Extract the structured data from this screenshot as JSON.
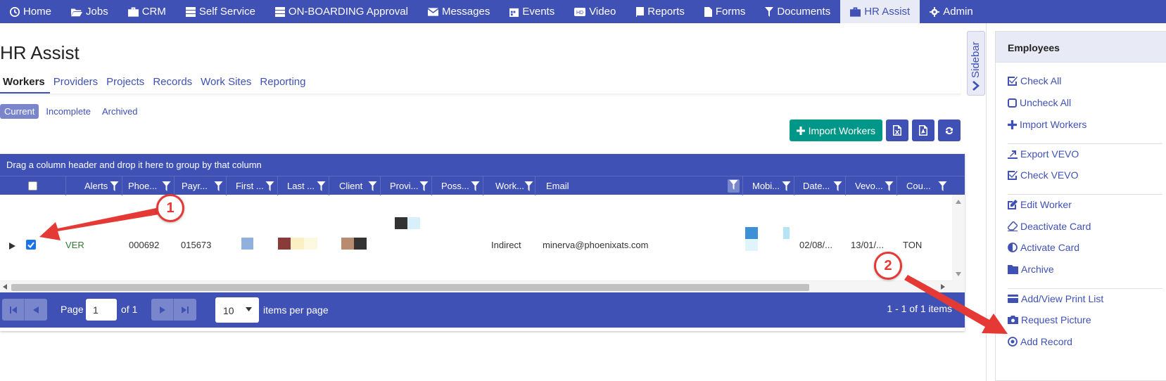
{
  "nav": [
    {
      "label": "Home",
      "icon": "clock-icon"
    },
    {
      "label": "Jobs",
      "icon": "folder-open-icon"
    },
    {
      "label": "CRM",
      "icon": "briefcase-icon"
    },
    {
      "label": "Self Service",
      "icon": "server-icon"
    },
    {
      "label": "ON-BOARDING Approval",
      "icon": "server-icon"
    },
    {
      "label": "Messages",
      "icon": "envelope-icon"
    },
    {
      "label": "Events",
      "icon": "calendar-icon"
    },
    {
      "label": "Video",
      "icon": "video-icon"
    },
    {
      "label": "Reports",
      "icon": "book-icon"
    },
    {
      "label": "Forms",
      "icon": "file-icon"
    },
    {
      "label": "Documents",
      "icon": "filter-icon"
    },
    {
      "label": "HR Assist",
      "icon": "briefcase-icon"
    },
    {
      "label": "Admin",
      "icon": "gear-icon"
    }
  ],
  "page_title": "HR Assist",
  "tabs": [
    "Workers",
    "Providers",
    "Projects",
    "Records",
    "Work Sites",
    "Reporting"
  ],
  "subtabs": [
    "Current",
    "Incomplete",
    "Archived"
  ],
  "toolbar": {
    "import_label": "Import Workers"
  },
  "grid": {
    "group_hint": "Drag a column header and drop it here to group by that column",
    "columns": [
      "Alerts",
      "Phoe...",
      "Payr...",
      "First ...",
      "Last ...",
      "Client",
      "Provi...",
      "Poss...",
      "Work...",
      "Email",
      "Mobi...",
      "Date...",
      "Vevo...",
      "Cou..."
    ],
    "row": {
      "alerts": "VER",
      "phoenix": "000692",
      "payroll": "015673",
      "work_type": "Indirect",
      "email": "minerva@phoenixats.com",
      "date": "02/08/...",
      "vevo": "13/01/...",
      "country": "TON"
    }
  },
  "pager": {
    "page_label": "Page",
    "page_value": "1",
    "of_label": "of 1",
    "per_page_value": "10",
    "per_page_label": "items per page",
    "summary": "1 - 1 of 1 items"
  },
  "sidebar_tab_label": "Sidebar",
  "panel": {
    "title": "Employees",
    "items": [
      {
        "label": "Check All",
        "icon": "check-square-icon"
      },
      {
        "label": "Uncheck All",
        "icon": "square-icon"
      },
      {
        "label": "Import Workers",
        "icon": "plus-icon"
      },
      {
        "label": "Export VEVO",
        "icon": "export-icon"
      },
      {
        "label": "Check VEVO",
        "icon": "check-square-icon"
      },
      {
        "label": "Edit Worker",
        "icon": "edit-icon"
      },
      {
        "label": "Deactivate Card",
        "icon": "eraser-icon"
      },
      {
        "label": "Activate Card",
        "icon": "half-circle-icon"
      },
      {
        "label": "Archive",
        "icon": "folder-icon"
      },
      {
        "label": "Add/View Print List",
        "icon": "credit-card-icon"
      },
      {
        "label": "Request Picture",
        "icon": "camera-icon"
      },
      {
        "label": "Add Record",
        "icon": "dot-circle-icon"
      }
    ]
  },
  "callouts": [
    "1",
    "2"
  ],
  "colors": {
    "primary": "#3f51b5",
    "accent": "#009688",
    "annotation": "#e53935"
  }
}
